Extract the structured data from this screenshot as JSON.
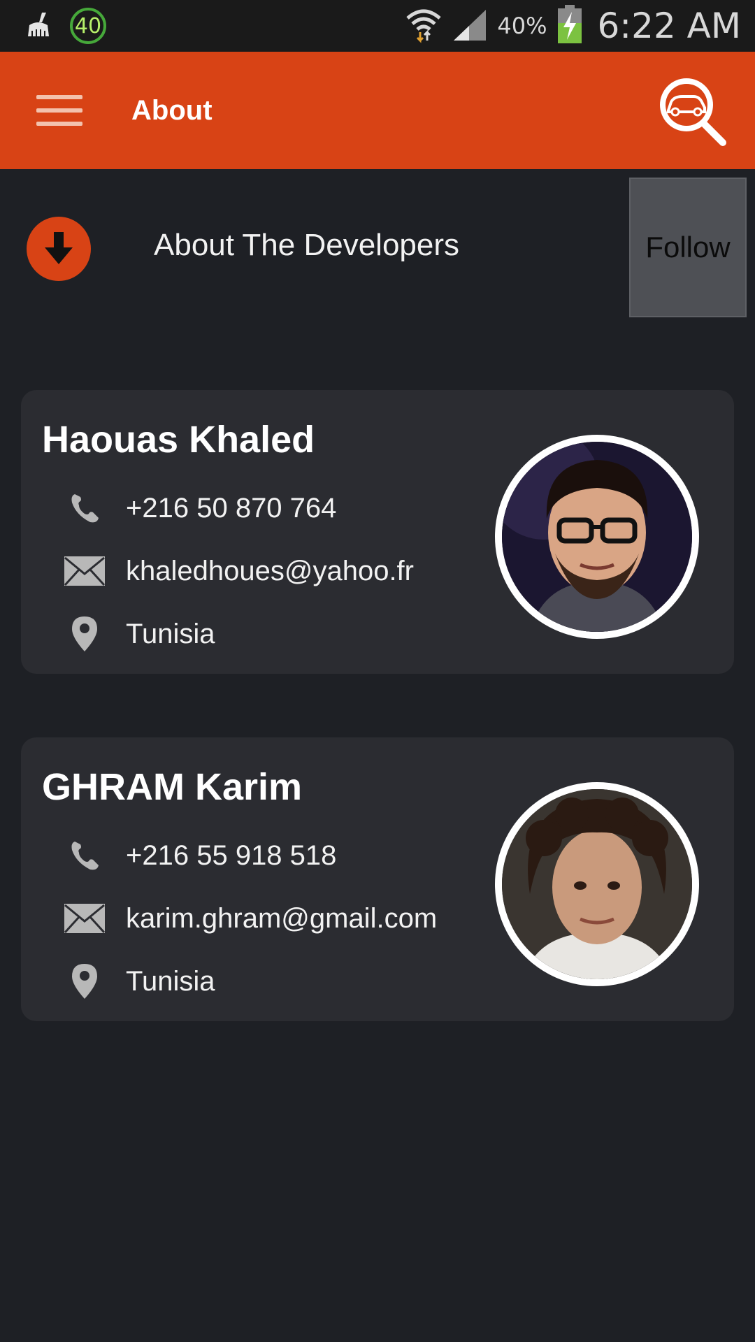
{
  "status_bar": {
    "badge": "40",
    "battery_percent": "40%",
    "time": "6:22 AM",
    "icons": [
      "broom-icon",
      "wifi-icon",
      "signal-icon",
      "battery-charging-icon"
    ]
  },
  "app_bar": {
    "title": "About",
    "menu_icon": "hamburger-menu-icon",
    "action_icon": "car-search-icon",
    "color": "#d84315"
  },
  "header": {
    "title": "About The Developers",
    "follow_label": "Follow",
    "icon": "arrow-down-circle-icon"
  },
  "developers": [
    {
      "name": "Haouas Khaled",
      "phone": "+216 50 870 764",
      "email": "khaledhoues@yahoo.fr",
      "location": "Tunisia"
    },
    {
      "name": "GHRAM Karim",
      "phone": "+216 55 918 518",
      "email": "karim.ghram@gmail.com",
      "location": "Tunisia"
    }
  ]
}
